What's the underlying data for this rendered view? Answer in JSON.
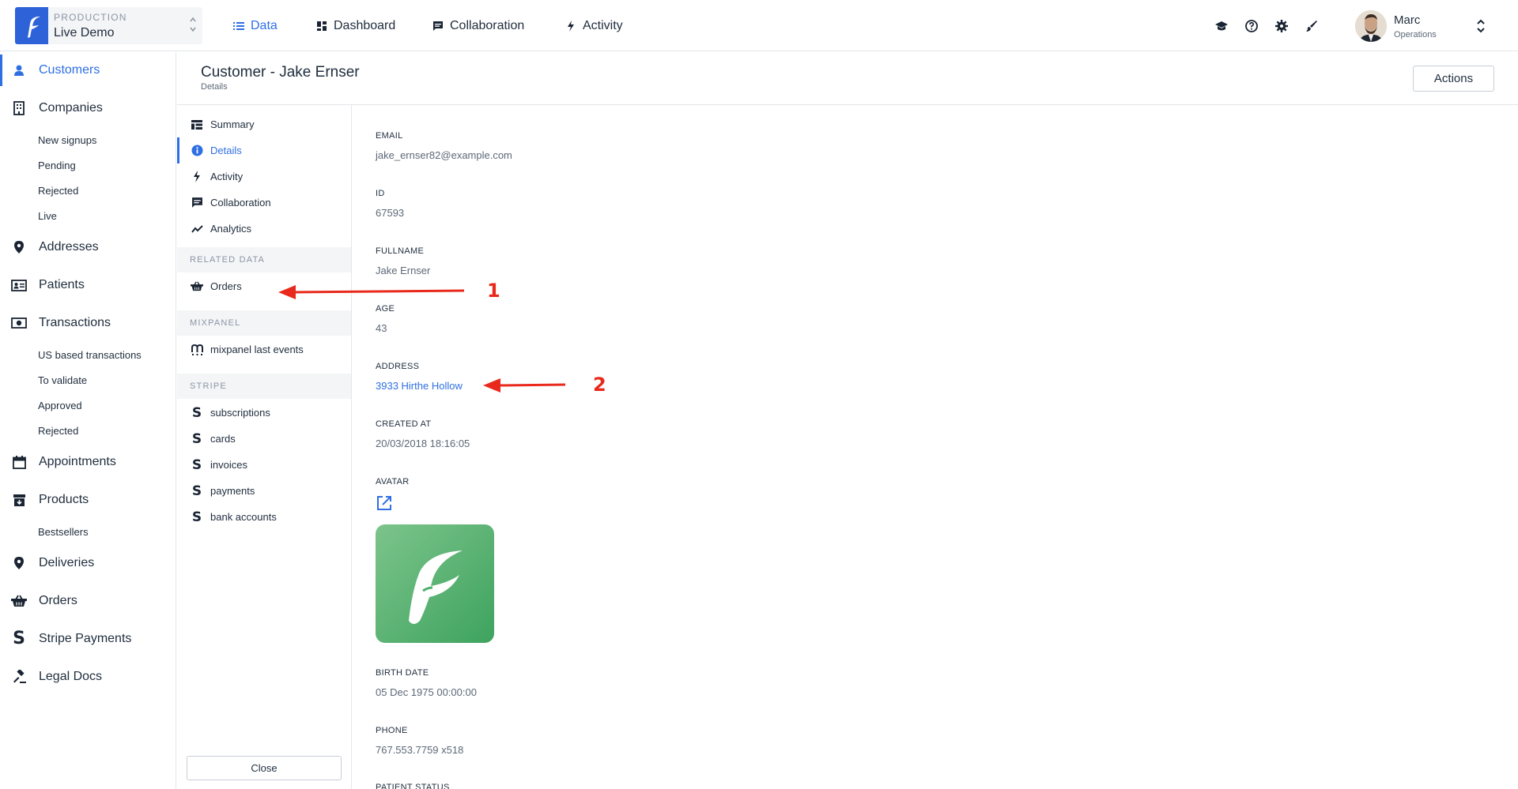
{
  "environment": {
    "label": "PRODUCTION",
    "name": "Live Demo"
  },
  "topnav": [
    {
      "label": "Data",
      "icon": "list-icon",
      "active": true
    },
    {
      "label": "Dashboard",
      "icon": "dashboard-icon",
      "active": false
    },
    {
      "label": "Collaboration",
      "icon": "comment-icon",
      "active": false
    },
    {
      "label": "Activity",
      "icon": "bolt-icon",
      "active": false
    }
  ],
  "toolbar_icons": [
    "graduation-cap-icon",
    "help-circle-icon",
    "gear-icon",
    "paint-brush-icon"
  ],
  "user": {
    "name": "Marc",
    "role": "Operations"
  },
  "sidebar": {
    "items": [
      {
        "label": "Customers",
        "icon": "person-icon",
        "active": true
      },
      {
        "label": "Companies",
        "icon": "building-icon"
      },
      {
        "label": "Addresses",
        "icon": "map-pin-icon"
      },
      {
        "label": "Patients",
        "icon": "id-card-icon"
      },
      {
        "label": "Transactions",
        "icon": "money-icon"
      },
      {
        "label": "Appointments",
        "icon": "calendar-icon"
      },
      {
        "label": "Products",
        "icon": "archive-box-icon"
      },
      {
        "label": "Deliveries",
        "icon": "map-pin-icon"
      },
      {
        "label": "Orders",
        "icon": "basket-icon"
      },
      {
        "label": "Stripe Payments",
        "icon": "stripe-icon"
      },
      {
        "label": "Legal Docs",
        "icon": "gavel-icon"
      }
    ],
    "companies_sub": [
      "New signups",
      "Pending",
      "Rejected",
      "Live"
    ],
    "transactions_sub": [
      "US based transactions",
      "To validate",
      "Approved",
      "Rejected"
    ],
    "products_sub": [
      "Bestsellers"
    ]
  },
  "header": {
    "title": "Customer - Jake Ernser",
    "subtitle": "Details",
    "actions_label": "Actions"
  },
  "panel": {
    "items": [
      {
        "label": "Summary",
        "icon": "summary-icon"
      },
      {
        "label": "Details",
        "icon": "info-icon",
        "active": true
      },
      {
        "label": "Activity",
        "icon": "bolt-icon"
      },
      {
        "label": "Collaboration",
        "icon": "comment-icon"
      },
      {
        "label": "Analytics",
        "icon": "trend-icon"
      }
    ],
    "related_section": "RELATED DATA",
    "related_items": [
      {
        "label": "Orders",
        "icon": "basket-icon"
      }
    ],
    "mixpanel_section": "MIXPANEL",
    "mixpanel_items": [
      {
        "label": "mixpanel last events",
        "icon": "mixpanel-icon"
      }
    ],
    "stripe_section": "STRIPE",
    "stripe_items": [
      "subscriptions",
      "cards",
      "invoices",
      "payments",
      "bank accounts"
    ],
    "stripe_glyph": "S",
    "close_label": "Close"
  },
  "fields": [
    {
      "label": "EMAIL",
      "value": "jake_ernser82@example.com"
    },
    {
      "label": "ID",
      "value": "67593"
    },
    {
      "label": "FULLNAME",
      "value": "Jake Ernser"
    },
    {
      "label": "AGE",
      "value": "43"
    },
    {
      "label": "ADDRESS",
      "value": "3933 Hirthe Hollow",
      "link": true
    },
    {
      "label": "CREATED AT",
      "value": "20/03/2018 18:16:05"
    },
    {
      "label": "AVATAR",
      "value": ""
    },
    {
      "label": "BIRTH DATE",
      "value": "05 Dec 1975 00:00:00"
    },
    {
      "label": "PHONE",
      "value": "767.553.7759 x518"
    },
    {
      "label": "PATIENT STATUS",
      "value": ""
    }
  ],
  "annotations": [
    {
      "number": "1",
      "color": "#e8291c"
    },
    {
      "number": "2",
      "color": "#e8291c"
    }
  ],
  "colors": {
    "accent": "#2e6fe3",
    "brand": "#2e62d9",
    "avatar_green": "#4caf6a",
    "annotation_red": "#e8291c"
  }
}
